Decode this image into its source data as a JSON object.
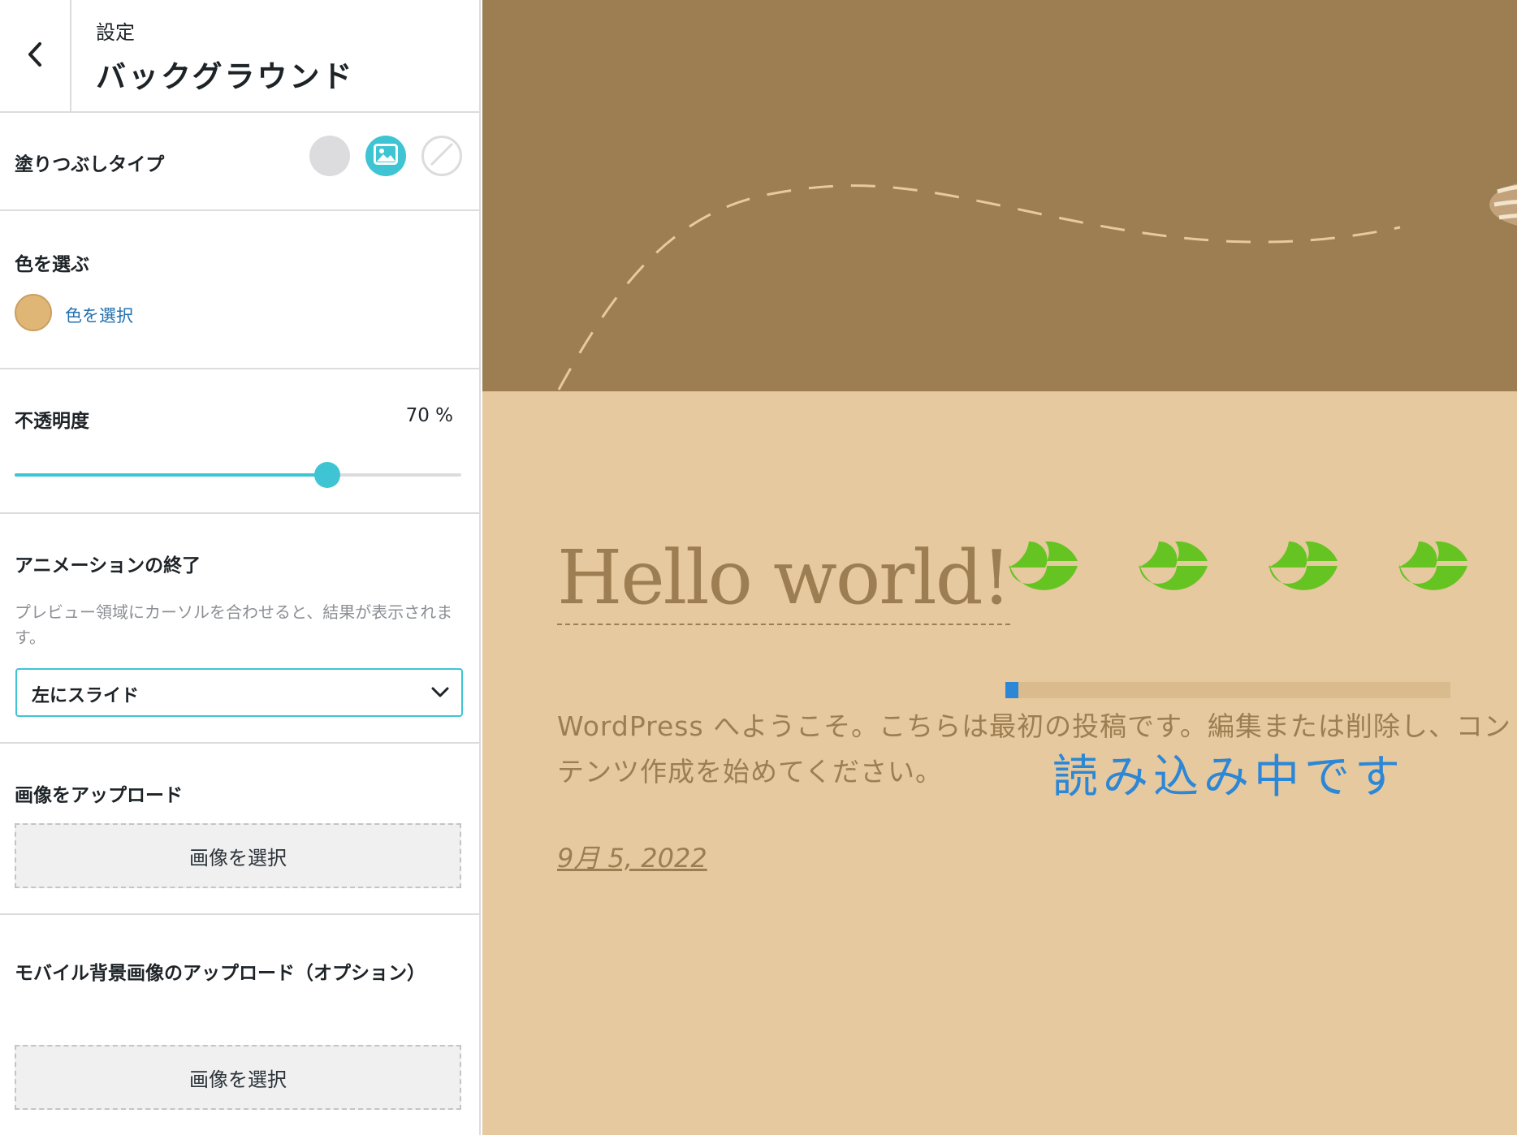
{
  "header": {
    "subtitle": "設定",
    "title": "バックグラウンド"
  },
  "fill_type": {
    "label": "塗りつぶしタイプ",
    "options": [
      "color",
      "image",
      "none"
    ],
    "selected": "image"
  },
  "color": {
    "label": "色を選ぶ",
    "link_text": "色を選択",
    "swatch": "#e0b676"
  },
  "opacity": {
    "label": "不透明度",
    "value_text": "70 %",
    "value": 70
  },
  "animation": {
    "label": "アニメーションの終了",
    "description": "プレビュー領域にカーソルを合わせると、結果が表示されます。",
    "selected": "左にスライド"
  },
  "upload": {
    "label": "画像をアップロード",
    "button": "画像を選択"
  },
  "mobile_upload": {
    "label": "モバイル背景画像のアップロード（オプション）",
    "button": "画像を選択"
  },
  "preview": {
    "post_title": "Hello world!",
    "excerpt": "WordPress へようこそ。こちらは最初の投稿です。編集または削除し、コンテンツ作成を始めてください。",
    "loading_text": "読み込み中です",
    "date": "9月 5, 2022",
    "loading_progress": 0.03
  },
  "colors": {
    "accent": "#3fc4d3",
    "link": "#2271b1",
    "hero_bg": "#9c7e52",
    "content_bg": "#e6c99e",
    "loading_blue": "#2c87d6",
    "leaf_green": "#65c422"
  }
}
